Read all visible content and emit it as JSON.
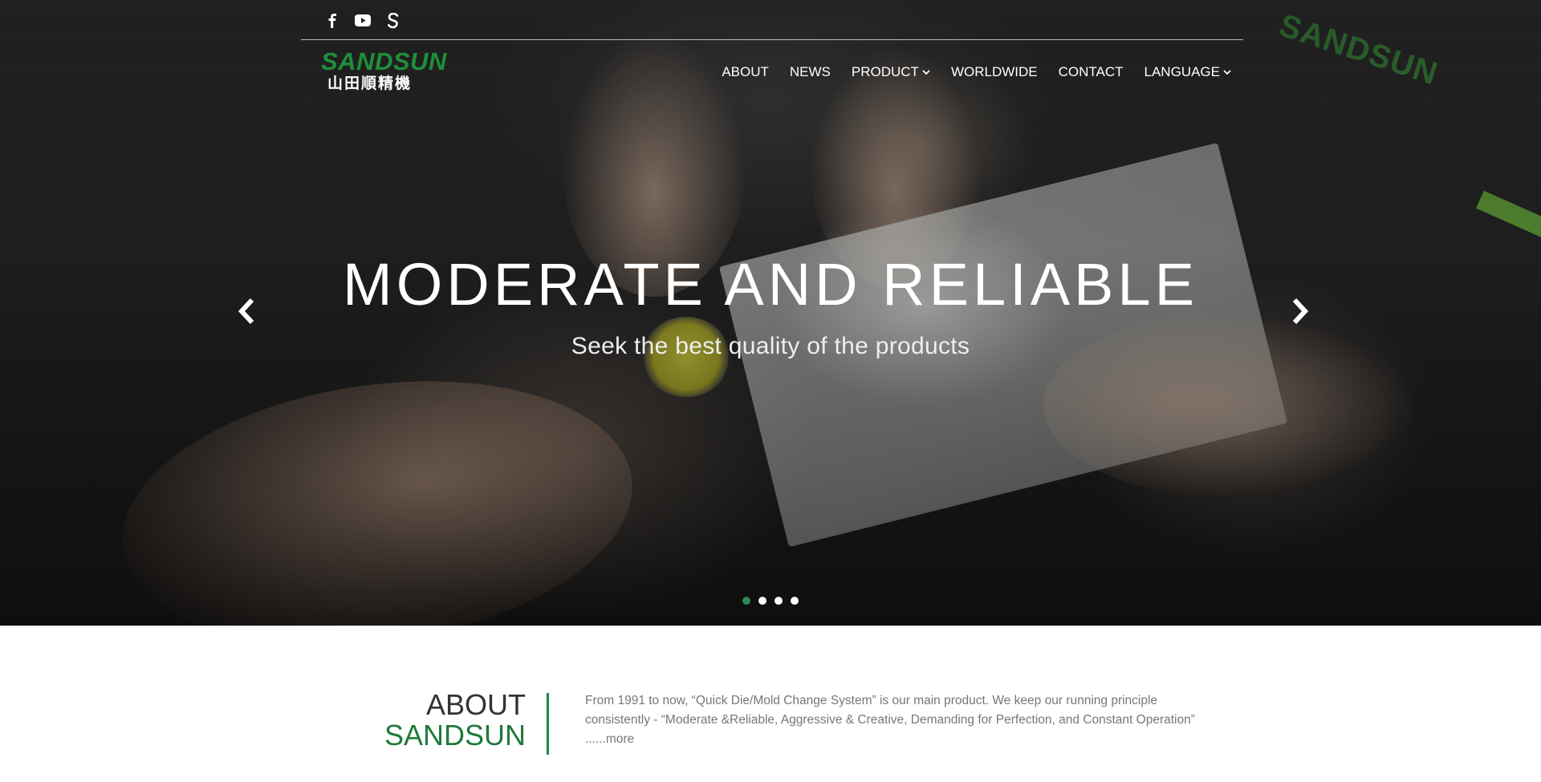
{
  "social": {
    "items": [
      {
        "icon": "facebook-icon"
      },
      {
        "icon": "youtube-icon"
      },
      {
        "icon": "sandsun-s-icon"
      }
    ]
  },
  "logo": {
    "brand_en": "SANDSUN",
    "brand_zh": "山田順精機",
    "colors": {
      "green": "#1f8f3a",
      "orange": "#e9581e"
    }
  },
  "nav": {
    "items": [
      {
        "label": "ABOUT",
        "has_dropdown": false
      },
      {
        "label": "NEWS",
        "has_dropdown": false
      },
      {
        "label": "PRODUCT",
        "has_dropdown": true
      },
      {
        "label": "WORLDWIDE",
        "has_dropdown": false
      },
      {
        "label": "CONTACT",
        "has_dropdown": false
      },
      {
        "label": "LANGUAGE",
        "has_dropdown": true
      }
    ]
  },
  "hero": {
    "headline": "MODERATE AND RELIABLE",
    "subline": "Seek the best quality of the products",
    "slide_count": 4,
    "active_slide": 1,
    "shirt_logo": "SANDSUN"
  },
  "about": {
    "title_line1": "ABOUT",
    "title_line2": "SANDSUN",
    "text": "From 1991 to now, “Quick Die/Mold Change System” is our main product. We keep our running principle consistently - “Moderate &Reliable, Aggressive & Creative, Demanding for Perfection, and Constant Operation” ......",
    "more_label": "more"
  },
  "colors": {
    "accent_green": "#1f8a3a",
    "active_dot": "#2e8b57"
  }
}
